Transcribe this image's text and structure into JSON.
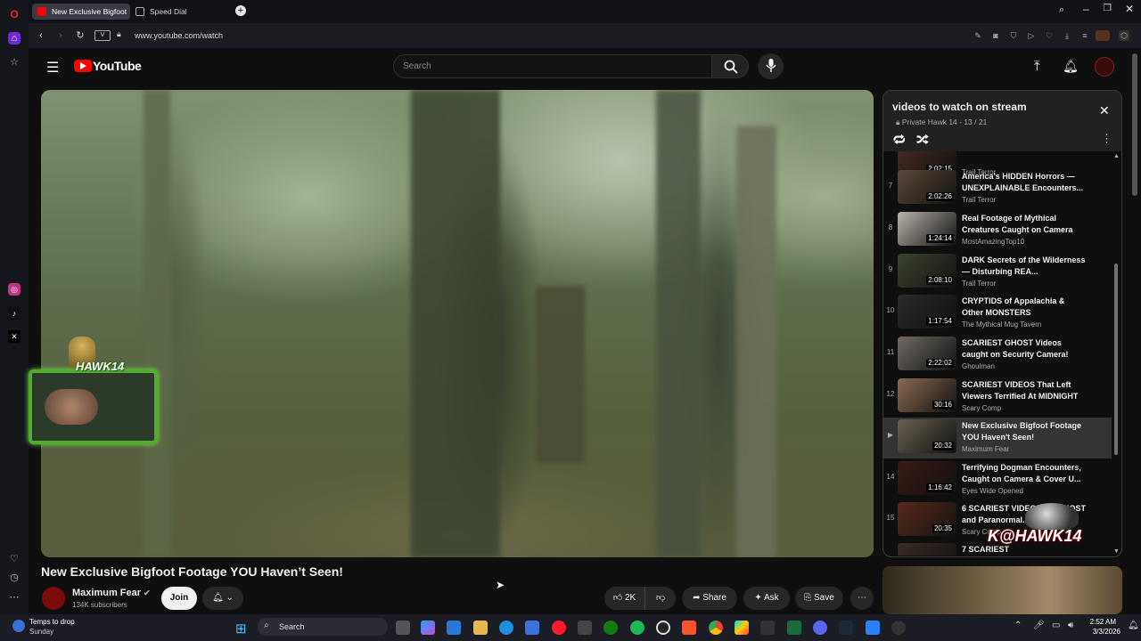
{
  "browser": {
    "tabs": [
      {
        "label": "New Exclusive Bigfoot",
        "active": true
      },
      {
        "label": "Speed Dial",
        "active": false
      }
    ],
    "new_tab_icon": "plus-icon",
    "url": "www.youtube.com/watch",
    "site_badge": "V"
  },
  "youtube": {
    "logo_text": "YouTube",
    "search_placeholder": "Search"
  },
  "overlay": {
    "streamer_name": "HAWK14",
    "watermark": "K@HAWK14"
  },
  "video": {
    "title": "New Exclusive Bigfoot Footage YOU Haven’t Seen!",
    "channel": "Maximum Fear",
    "subscribers": "134K subscribers",
    "join_label": "Join",
    "likes": "2K",
    "share_label": "Share",
    "ask_label": "Ask",
    "save_label": "Save"
  },
  "playlist": {
    "title": "videos to watch on stream",
    "meta": "Private Hawk 14 - 13 / 21",
    "items": [
      {
        "num": "",
        "title": "",
        "channel": "Trail Terror",
        "duration": "2:02:15",
        "color": "#4a2a22"
      },
      {
        "num": "7",
        "title": "America’s HIDDEN Horrors — UNEXPLAINABLE Encounters...",
        "channel": "Trail Terror",
        "duration": "2:02:26",
        "color": "#5a4a3a"
      },
      {
        "num": "8",
        "title": "Real Footage of Mythical Creatures Caught on Camera",
        "channel": "MostAmazingTop10",
        "duration": "1:24:14",
        "color": "#b9b3aa"
      },
      {
        "num": "9",
        "title": "DARK Secrets of the Wilderness — Disturbing REA...",
        "channel": "Trail Terror",
        "duration": "2:08:10",
        "color": "#3d4530"
      },
      {
        "num": "10",
        "title": "CRYPTIDS of Appalachia & Other MONSTERS",
        "channel": "The Mythical Mug Tavern",
        "duration": "1:17:54",
        "color": "#2b2b2b"
      },
      {
        "num": "11",
        "title": "SCARIEST GHOST Videos caught on Security Camera!",
        "channel": "Ghoulman",
        "duration": "2:22:02",
        "color": "#6f6a63"
      },
      {
        "num": "12",
        "title": "SCARIEST VIDEOS That Left Viewers Terrified At MIDNIGHT",
        "channel": "Scary Comp",
        "duration": "30:16",
        "color": "#8a6a52"
      },
      {
        "num": "▶",
        "title": "New Exclusive Bigfoot Footage YOU Haven't Seen!",
        "channel": "Maximum Fear",
        "duration": "20:32",
        "color": "#6a6250",
        "active": true
      },
      {
        "num": "14",
        "title": "Terrifying Dogman Encounters, Caught on Camera & Cover U...",
        "channel": "Eyes Wide Opened",
        "duration": "1:16:42",
        "color": "#3a1a14"
      },
      {
        "num": "15",
        "title": "6 SCARIEST VIDEOS OF GHOST and Paranormal...",
        "channel": "Scary Comp",
        "duration": "20:35",
        "color": "#5a2a1e"
      },
      {
        "num": "",
        "title": "7 SCARIEST",
        "channel": "",
        "duration": "",
        "color": "#3a2a22"
      }
    ]
  },
  "taskbar": {
    "weather_line1": "Temps to drop",
    "weather_line2": "Sunday",
    "search_label": "Search",
    "time": "2:52 AM",
    "date": "3/3/2026"
  }
}
